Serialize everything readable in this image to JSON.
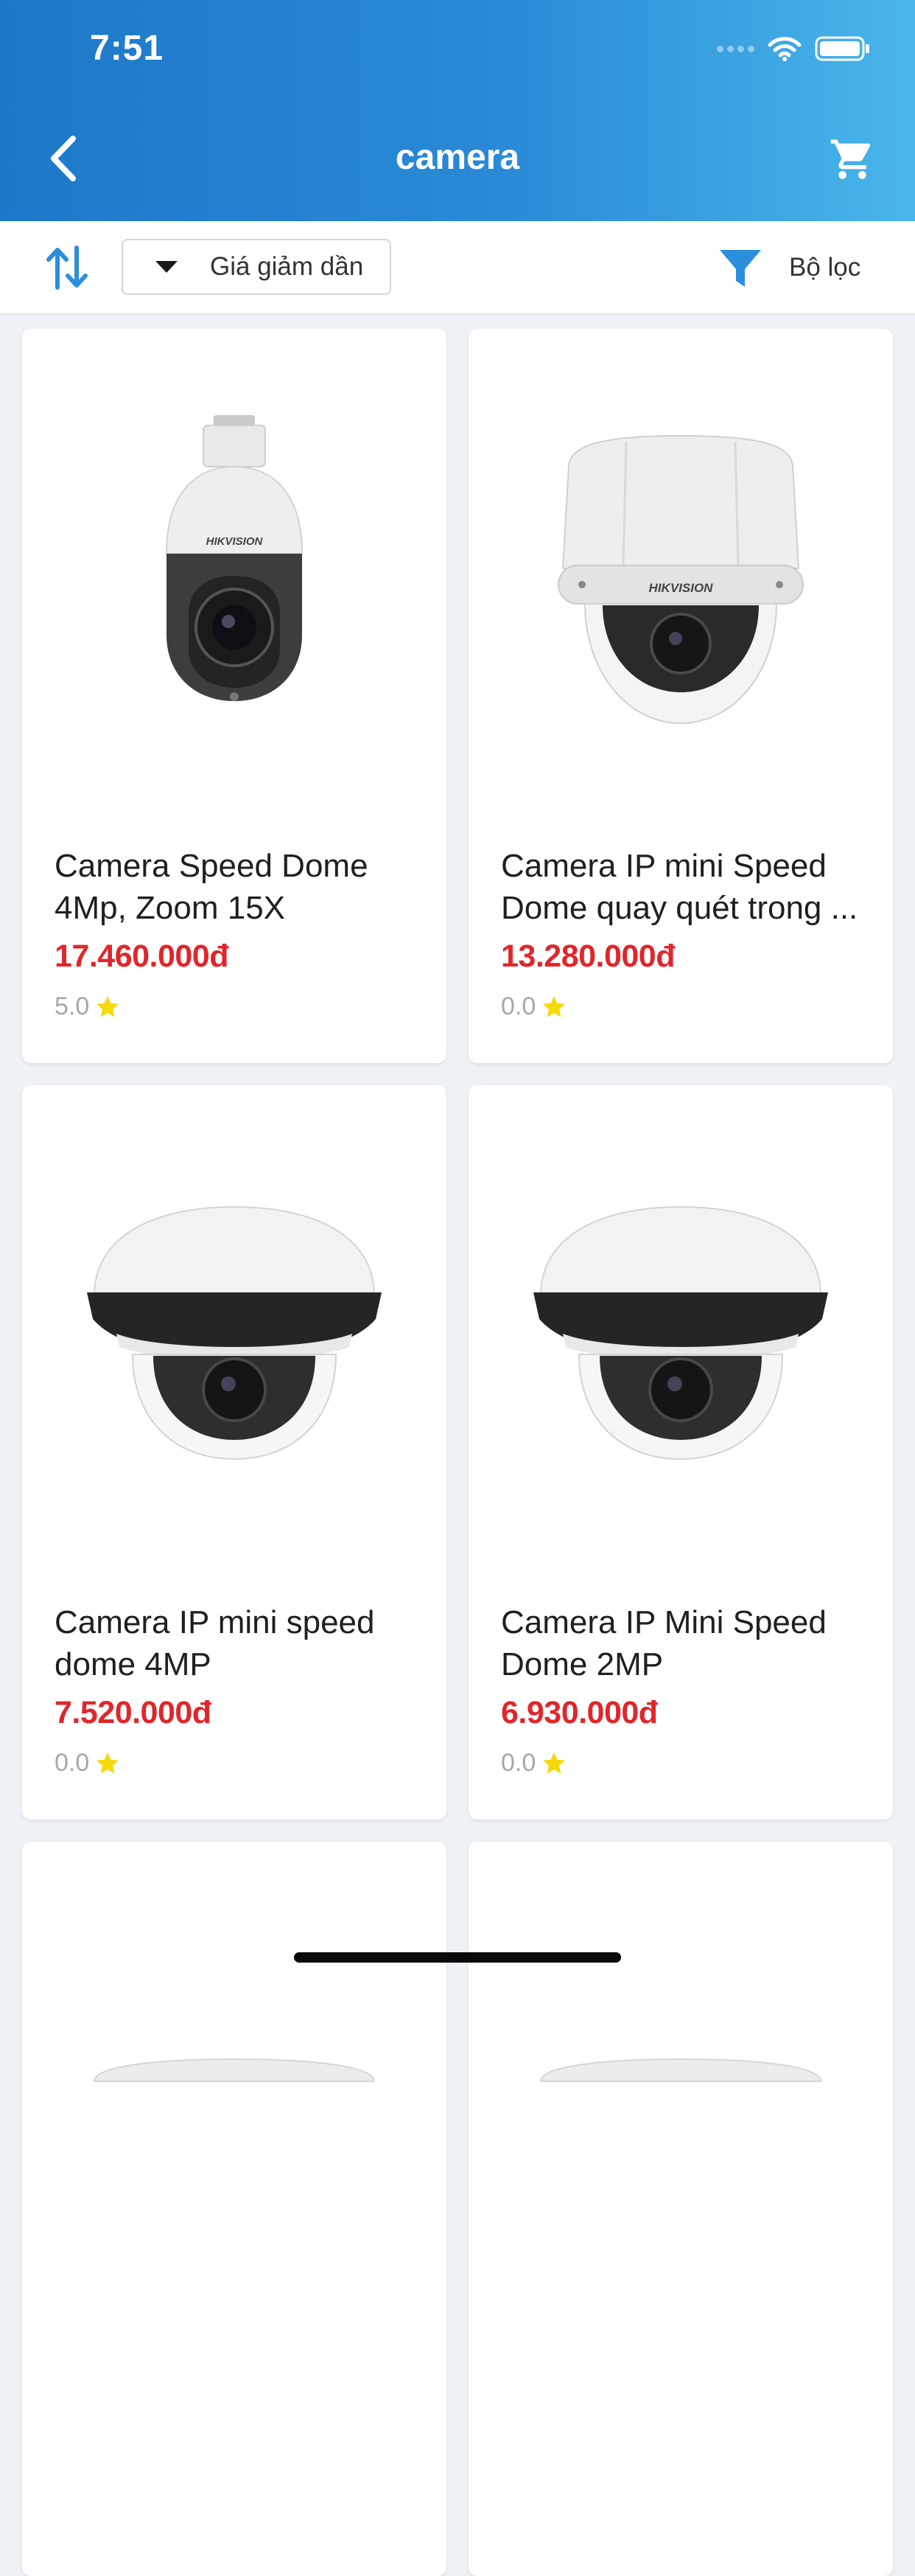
{
  "status_bar": {
    "time": "7:51"
  },
  "nav": {
    "title": "camera"
  },
  "toolbar": {
    "sort_label": "Giá giảm dần",
    "filter_label": "Bộ lọc"
  },
  "products": [
    {
      "name": "Camera Speed Dome 4Mp, Zoom 15X",
      "price": "17.460.000đ",
      "rating": "5.0",
      "image_icon": "ptz-camera-icon"
    },
    {
      "name": "Camera IP mini Speed Dome quay quét trong ...",
      "price": "13.280.000đ",
      "rating": "0.0",
      "image_icon": "dome-camera-icon"
    },
    {
      "name": "Camera IP mini speed dome 4MP",
      "price": "7.520.000đ",
      "rating": "0.0",
      "image_icon": "mini-dome-camera-icon"
    },
    {
      "name": "Camera IP Mini Speed Dome 2MP",
      "price": "6.930.000đ",
      "rating": "0.0",
      "image_icon": "mini-dome-camera-icon"
    },
    {
      "name": "",
      "price": "",
      "rating": "",
      "image_icon": "camera-image"
    },
    {
      "name": "",
      "price": "",
      "rating": "",
      "image_icon": "camera-image"
    }
  ],
  "colors": {
    "header_start": "#1e78c8",
    "header_end": "#49b6ea",
    "price": "#e0262b",
    "star": "#f5d90a",
    "accent_blue": "#2b8fde"
  }
}
